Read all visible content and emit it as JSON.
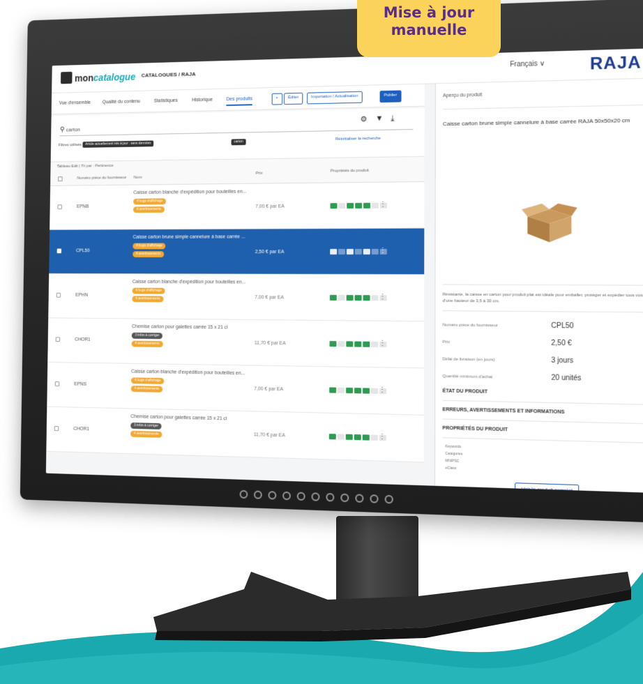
{
  "callout": {
    "line1": "Mise à jour",
    "line2": "manuelle"
  },
  "app": {
    "logo_prefix": "mon",
    "logo_suffix": "catalogue",
    "breadcrumb": "CATALOGUES / RAJA",
    "language": "Français ∨",
    "brand": "RAJA",
    "tabs": [
      "Vue d'ensemble",
      "Qualité du contenu",
      "Statistiques",
      "Historique",
      "Des produits"
    ],
    "buttons": {
      "edit": "Éditer",
      "import": "Importation / Actualisation",
      "publish": "Publier",
      "add": "+"
    }
  },
  "search": {
    "value": "carton",
    "filters_label": "Filtres utilisés",
    "chip1": "Article actuellement mis à jour : sans données",
    "chip2": "carton",
    "reset": "Réinitialiser la recherche"
  },
  "table": {
    "head_left": "Tableau Edit  |  Tri par : Pertinence",
    "col_ref": "Numéro pièce du fournisseur",
    "col_name": "Nom",
    "col_price": "Prix",
    "col_props": "Propriétés du produit",
    "rows": [
      {
        "ref": "EPNB",
        "title": "Caisse carton blanche d'expédition pour bouteilles en...",
        "pill1": "4 bugs d'affichage",
        "pill2": "4 avertissements",
        "price": "7,00 € par EA",
        "selected": false
      },
      {
        "ref": "CPL50",
        "title": "Caisse carton brune simple cannelure à base carrée ...",
        "pill1": "4 bugs d'affichage",
        "pill2": "4 avertissements",
        "price": "2,50 € par EA",
        "selected": true
      },
      {
        "ref": "EPHN",
        "title": "Caisse carton blanche d'expédition pour bouteilles en...",
        "pill1": "4 bugs d'affichage",
        "pill2": "4 avertissements",
        "price": "7,00 € par EA",
        "selected": false
      },
      {
        "ref": "CHOR1",
        "title": "Chemise carton pour galettes carrée 15 x 21 cl",
        "pill1": "3 infos à corriger",
        "pill2": "4 avertissements",
        "price": "11,70 € par EA",
        "selected": false
      },
      {
        "ref": "EPNS",
        "title": "Caisse carton blanche d'expédition pour bouteilles en...",
        "pill1": "4 bugs d'affichage",
        "pill2": "4 avertissements",
        "price": "7,00 € par EA",
        "selected": false
      },
      {
        "ref": "CHOR1",
        "title": "Chemise carton pour galettes carrée 15 x 21 cl",
        "pill1": "3 infos à corriger",
        "pill2": "4 avertissements",
        "price": "11,70 € par EA",
        "selected": false
      }
    ]
  },
  "preview": {
    "header": "Aperçu du produit",
    "title": "Caisse carton brune simple cannelure à base carrée RAJA 50x50x20 cm",
    "description": "Résistante, la caisse en carton pour produit plat est idéale pour emballer, protéger et expédier tous vos produits d'une hauteur de 3,5 à 30 cm.",
    "specs": [
      {
        "label": "Numéro pièce du fournisseur",
        "value": "CPL50"
      },
      {
        "label": "Prix",
        "value": "2,50 €"
      },
      {
        "label": "Délai de livraison (en jours)",
        "value": "3 jours"
      },
      {
        "label": "Quantité minimum d'achat",
        "value": "20 unités"
      }
    ],
    "sections": [
      "ÉTAT DU PRODUIT",
      "ERREURS, AVERTISSEMENTS ET INFORMATIONS",
      "PROPRIÉTÉS DU PRODUIT"
    ],
    "properties": [
      "Keywords",
      "Catégories",
      "MNIPSC",
      "eClass"
    ],
    "view_button": "Voir le produit complet"
  },
  "colors": {
    "accent_blue": "#1d5fbf",
    "selection_blue": "#1e5fae",
    "callout_yellow": "#fcd35a",
    "callout_text": "#5a2d8a",
    "teal_wave": "#1aa9ae",
    "warning_orange": "#f1a934",
    "ok_green": "#2e9a52"
  }
}
